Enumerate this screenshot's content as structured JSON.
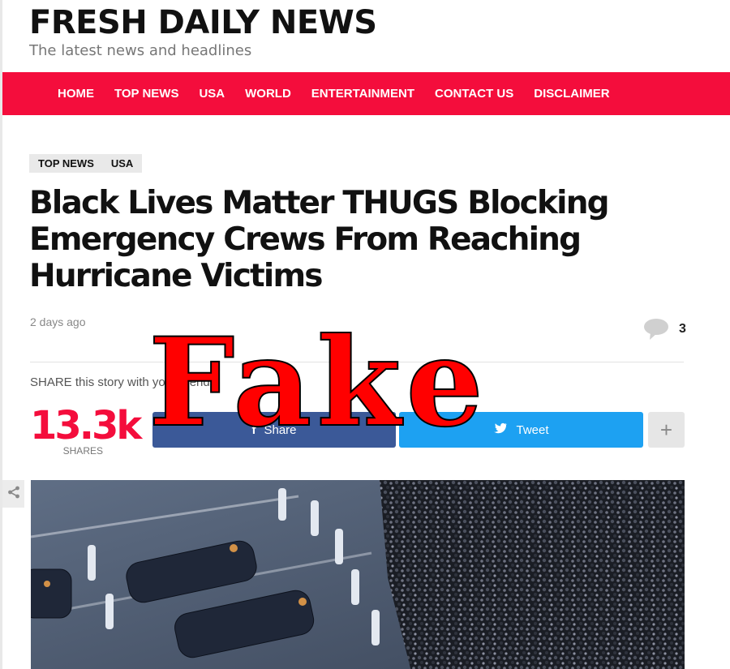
{
  "site": {
    "title": "FRESH DAILY NEWS",
    "tagline": "The latest news and headlines"
  },
  "nav": {
    "items": [
      {
        "label": "HOME"
      },
      {
        "label": "TOP NEWS"
      },
      {
        "label": "USA"
      },
      {
        "label": "WORLD"
      },
      {
        "label": "ENTERTAINMENT"
      },
      {
        "label": "CONTACT US"
      },
      {
        "label": "DISCLAIMER"
      }
    ]
  },
  "article": {
    "categories": [
      "TOP NEWS",
      "USA"
    ],
    "headline": "Black Lives Matter THUGS Blocking Emergency Crews From Reaching Hurricane Victims",
    "date": "2 days ago",
    "comment_count": "3"
  },
  "share": {
    "prompt": "SHARE this story with your friends!",
    "count": "13.3k",
    "count_label": "SHARES",
    "facebook_label": "Share",
    "twitter_label": "Tweet",
    "more_label": "+"
  },
  "overlay": {
    "stamp_text": "Fake"
  },
  "colors": {
    "brand": "#f40d3c",
    "facebook": "#3b5998",
    "twitter": "#1da1f2",
    "stamp": "#ff0000"
  }
}
